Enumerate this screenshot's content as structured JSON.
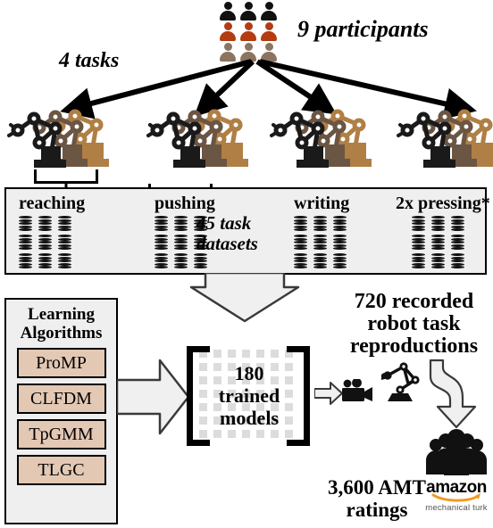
{
  "diagram": {
    "participants_label": "9 participants",
    "tasks_label": "4 tasks",
    "datasets_caption": "45 task datasets",
    "reproductions_label": "720 recorded robot task reproductions",
    "ratings_label": "3,600 AMT ratings"
  },
  "people": {
    "rows": [
      {
        "color": "#111111",
        "count": 3
      },
      {
        "color": "#b33c12",
        "count": 3
      },
      {
        "color": "#8b7460",
        "count": 3
      }
    ]
  },
  "robots": {
    "arm_colors": [
      "#1a1a1a",
      "#6b5543",
      "#b07f45"
    ],
    "groups": [
      {
        "name": "reaching"
      },
      {
        "name": "pushing"
      },
      {
        "name": "writing"
      },
      {
        "name": "pressing"
      }
    ]
  },
  "task_datasets": {
    "columns": [
      {
        "title": "reaching",
        "datasets": 9
      },
      {
        "title": "pushing",
        "datasets": 9
      },
      {
        "title": "writing",
        "datasets": 9
      },
      {
        "title": "2x pressing*",
        "datasets": 9
      }
    ],
    "total_caption": "45 task datasets"
  },
  "learning_algorithms": {
    "title_line1": "Learning",
    "title_line2": "Algorithms",
    "items": [
      {
        "label": "ProMP"
      },
      {
        "label": "CLFDM"
      },
      {
        "label": "TpGMM"
      },
      {
        "label": "TLGC"
      }
    ],
    "box_color": "#e3c8b4"
  },
  "trained_models": {
    "line1": "180",
    "line2": "trained",
    "line3": "models"
  },
  "reproductions": {
    "line1": "720 recorded",
    "line2": "robot task",
    "line3": "reproductions"
  },
  "ratings": {
    "line1": "3,600 AMT",
    "line2": "ratings"
  },
  "amt": {
    "brand": "amazon",
    "sub": "mechanical turk",
    "accent": "#f19b1f"
  },
  "colors": {
    "panel_bg": "#efefef",
    "panel_border": "#000000",
    "arrow_fill": "#f0f0f0",
    "arrow_stroke": "#3a3a3a",
    "grid_square": "#dcdcdc"
  }
}
